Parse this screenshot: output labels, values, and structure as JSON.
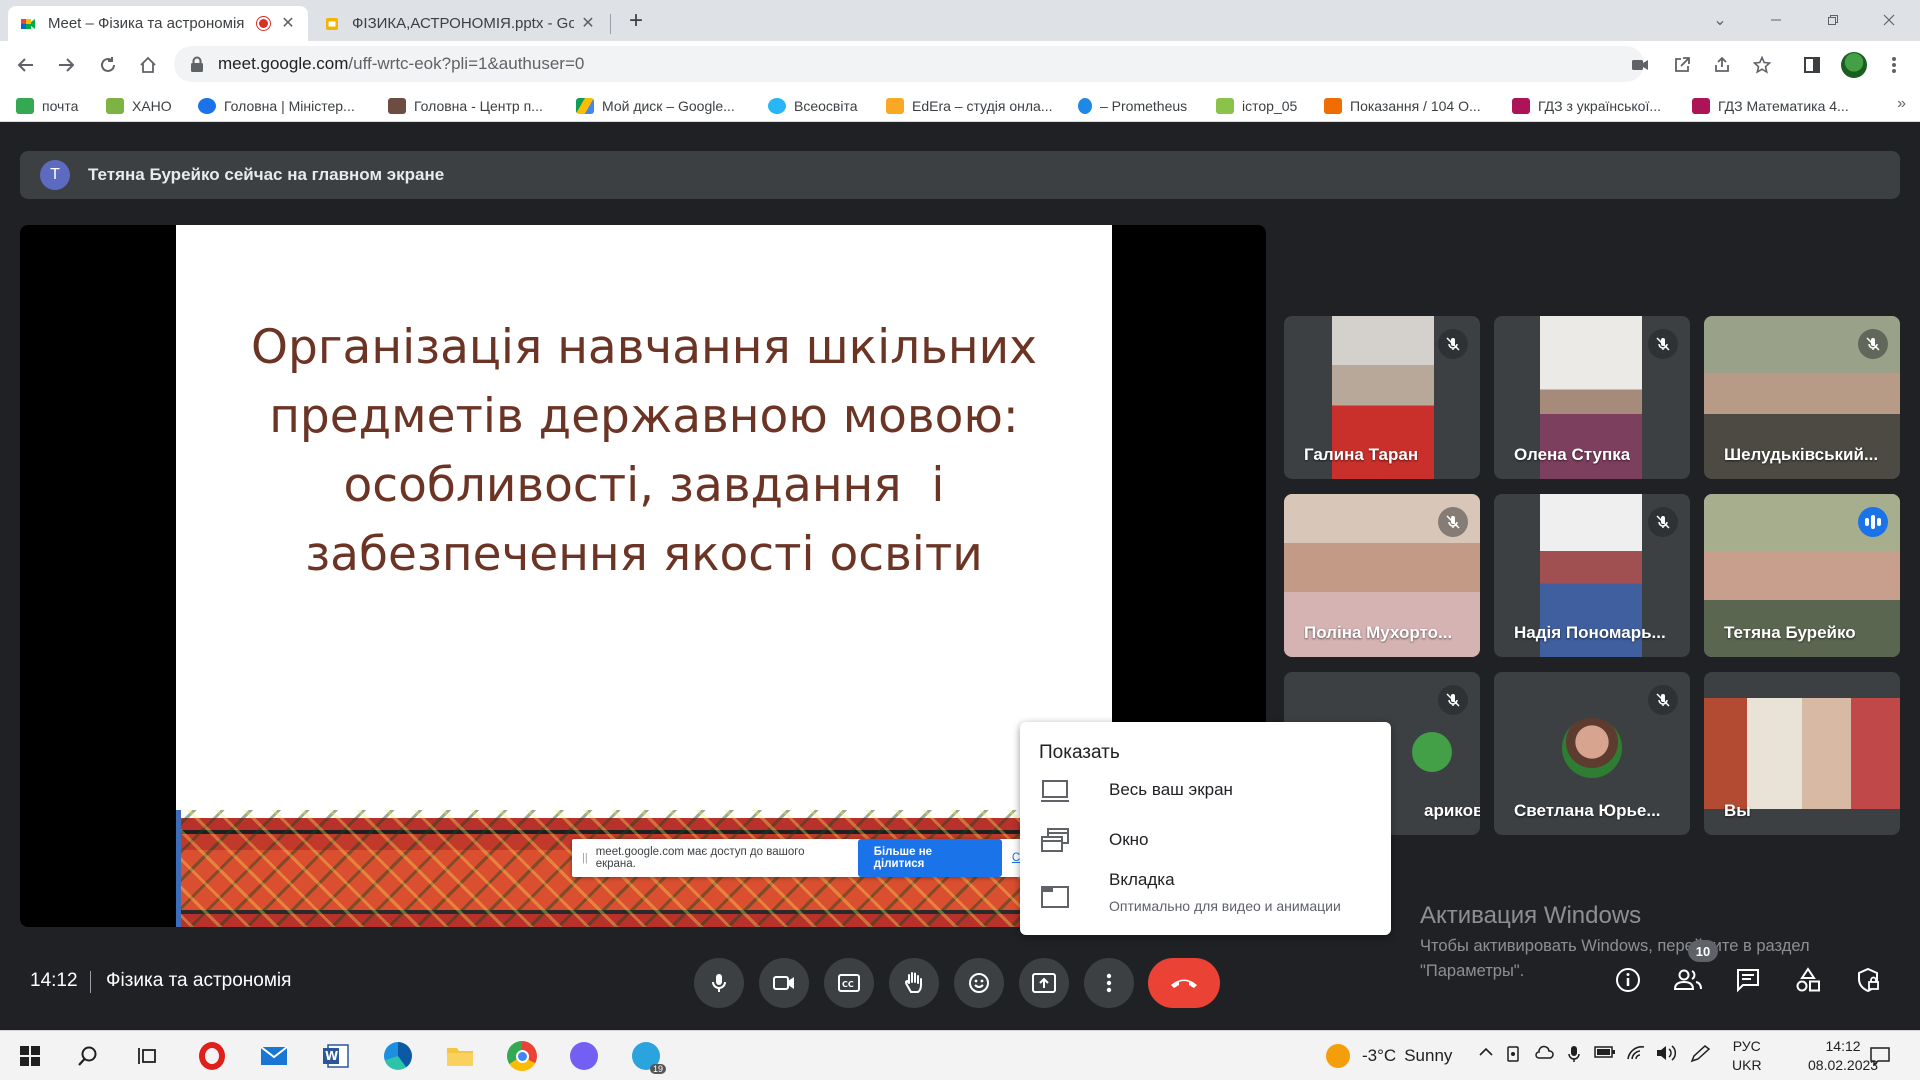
{
  "browser": {
    "tabs": [
      {
        "title": "Meet – Фізика та астрономія",
        "active": true,
        "recording": true
      },
      {
        "title": "ФІЗИКА,АСТРОНОМІЯ.pptx - Google",
        "active": false,
        "recording": false
      }
    ],
    "new_tab_label": "+",
    "url_host": "meet.google.com",
    "url_path": "/uff-wrtc-eok?pli=1&authuser=0",
    "bookmarks": [
      {
        "label": "почта",
        "icon": "mail-icon",
        "color": "#34a853"
      },
      {
        "label": "ХАНО",
        "icon": "plant-icon",
        "color": "#7cb342"
      },
      {
        "label": "Головна | Міністер...",
        "icon": "ministry-icon",
        "color": "#1a73e8"
      },
      {
        "label": "Головна - Центр п...",
        "icon": "center-icon",
        "color": "#6d4c41"
      },
      {
        "label": "Мой диск – Google...",
        "icon": "drive-icon",
        "color": "#fbbc04"
      },
      {
        "label": "Всеосвіта",
        "icon": "snowflake-icon",
        "color": "#29b6f6"
      },
      {
        "label": "EdEra – студія онла...",
        "icon": "edera-icon",
        "color": "#f9a825"
      },
      {
        "label": "– Prometheus",
        "icon": "prometheus-icon",
        "color": "#1e88e5"
      },
      {
        "label": "істор_05",
        "icon": "history-icon",
        "color": "#8bc34a"
      },
      {
        "label": "Показання / 104 О...",
        "icon": "meter-icon",
        "color": "#ef6c00"
      },
      {
        "label": "ГДЗ з української...",
        "icon": "book-icon",
        "color": "#ad1457"
      },
      {
        "label": "ГДЗ Математика 4...",
        "icon": "book-icon",
        "color": "#ad1457"
      }
    ],
    "bookmarks_more": "»"
  },
  "meet": {
    "banner": {
      "avatar_letter": "Т",
      "text": "Тетяна Бурейко сейчас на главном экране"
    },
    "slide": {
      "title_lines": [
        "Організація навчання шкільних",
        "предметів державною мовою:",
        "особливості, завдання  і",
        "забезпечення якості освіти"
      ]
    },
    "share_notice": {
      "grip": "||",
      "text": "meet.google.com має доступ до вашого екрана.",
      "stop_label": "Більше не ділитися",
      "hide_label": "Сховати"
    },
    "participants": [
      {
        "name": "Галина Таран",
        "muted": true,
        "speaking": false
      },
      {
        "name": "Олена Ступка",
        "muted": true,
        "speaking": false
      },
      {
        "name": "Шелудьківський...",
        "muted": true,
        "speaking": false
      },
      {
        "name": "Поліна Мухорто...",
        "muted": true,
        "speaking": false
      },
      {
        "name": "Надія Пономарь...",
        "muted": true,
        "speaking": false
      },
      {
        "name": "Тетяна Бурейко",
        "muted": false,
        "speaking": true
      },
      {
        "name": "арик​ов",
        "muted": true,
        "speaking": false
      },
      {
        "name": "Светлана Юрье...",
        "muted": true,
        "speaking": false
      },
      {
        "name": "Вы",
        "muted": false,
        "speaking": false
      }
    ],
    "share_menu": {
      "title": "Показать",
      "items": [
        {
          "label": "Весь ваш экран",
          "sub": "",
          "icon": "monitor-icon"
        },
        {
          "label": "Окно",
          "sub": "",
          "icon": "window-icon"
        },
        {
          "label": "Вкладка",
          "sub": "Оптимально для видео и анимации",
          "icon": "tab-icon"
        }
      ]
    },
    "activation": {
      "title": "Активация Windows",
      "line1": "Чтобы активировать Windows, перейдите в раздел",
      "line2": "\"Параметры\"."
    },
    "bottom": {
      "time": "14:12",
      "meeting_name": "Фізика та астрономія",
      "people_count": "10"
    }
  },
  "taskbar": {
    "weather_temp": "-3°C",
    "weather_text": "Sunny",
    "lang_top": "РУС",
    "lang_bottom": "UKR",
    "time": "14:12",
    "date": "08.02.2023",
    "telegram_badge": "19"
  },
  "colors": {
    "meet_bg": "#202124",
    "end_call": "#ea4335",
    "accent": "#1a73e8",
    "slide_text": "#6b3424"
  }
}
